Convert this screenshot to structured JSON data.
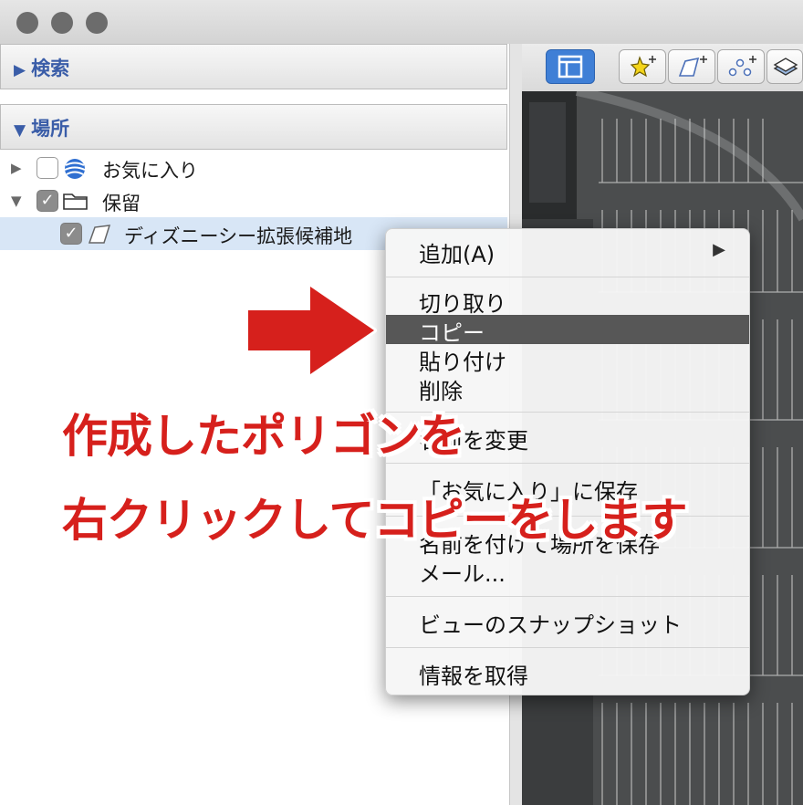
{
  "window": {
    "traffic_lights": [
      "close",
      "minimize",
      "zoom"
    ]
  },
  "sidebar": {
    "search_header": "検索",
    "places_header": "場所",
    "tree": [
      {
        "label": "お気に入り",
        "checked": false,
        "icon": "globe-icon",
        "expanded": false
      },
      {
        "label": "保留",
        "checked": true,
        "icon": "folder-icon",
        "expanded": true
      },
      {
        "label": "ディズニーシー拡張候補地",
        "checked": true,
        "icon": "polygon-icon",
        "selected": true
      }
    ]
  },
  "toolbar": {
    "buttons": [
      "sidebar-toggle-icon",
      "add-placemark-icon",
      "add-polygon-icon",
      "add-path-icon",
      "add-overlay-icon"
    ]
  },
  "context_menu": {
    "items": [
      {
        "label": "追加(A)",
        "submenu": true
      },
      {
        "label": "切り取り"
      },
      {
        "label": "コピー",
        "highlighted": true
      },
      {
        "label": "貼り付け"
      },
      {
        "label": "削除"
      },
      {
        "label": "名前を変更"
      },
      {
        "label": "「お気に入り」に保存"
      },
      {
        "label": "名前を付けて場所を保存"
      },
      {
        "label": "メール..."
      },
      {
        "label": "ビューのスナップショット"
      },
      {
        "label": "情報を取得"
      }
    ],
    "submenu_arrow": "▶"
  },
  "annotation": {
    "line1": "作成したポリゴンを",
    "line2": "右クリックしてコピーをします",
    "color": "#d6201c"
  }
}
